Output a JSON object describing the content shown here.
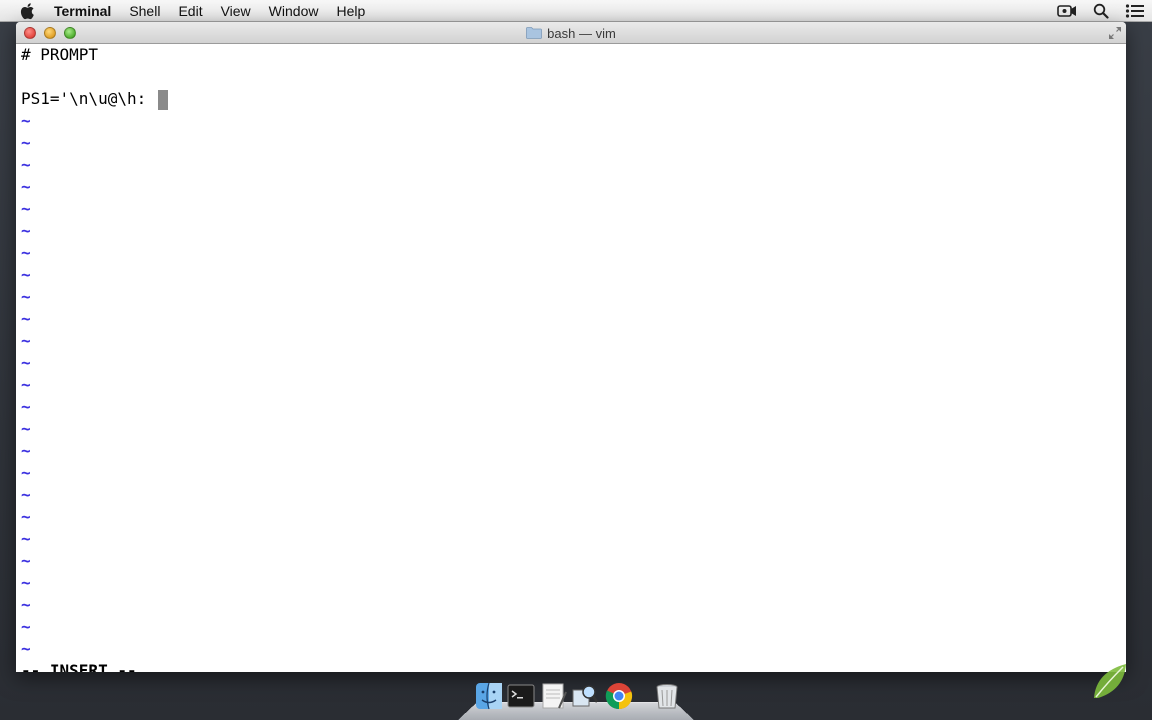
{
  "menubar": {
    "app_name": "Terminal",
    "items": [
      "Shell",
      "Edit",
      "View",
      "Window",
      "Help"
    ],
    "right_icons": [
      "camera-icon",
      "spotlight-search-icon",
      "notification-list-icon"
    ]
  },
  "window": {
    "title": "bash — vim"
  },
  "editor": {
    "lines": [
      "# PROMPT",
      "",
      "PS1='\\n\\u@\\h: "
    ],
    "tilde": "~",
    "mode_line": "-- INSERT --"
  },
  "dock": {
    "icons": [
      "finder-icon",
      "terminal-icon",
      "textedit-icon",
      "preview-icon",
      "chrome-icon",
      "trash-icon"
    ]
  },
  "colors": {
    "tilde": "#3a2fe0",
    "cursor": "#8a8a8a",
    "window_bg": "#ffffff"
  }
}
